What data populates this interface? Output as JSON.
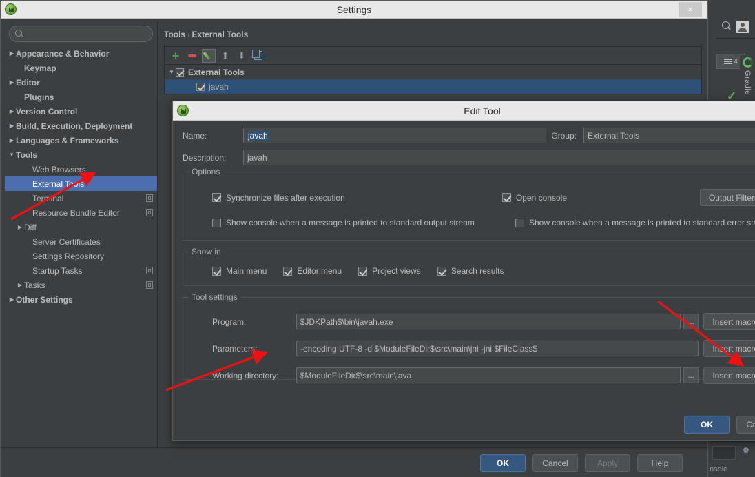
{
  "window": {
    "title": "Settings",
    "close_label": "×",
    "icon": "android-studio-icon"
  },
  "sidebar": {
    "search": {
      "value": "",
      "placeholder": ""
    },
    "items": [
      {
        "label": "Appearance & Behavior",
        "arrow": "▶",
        "bold": true,
        "indent": 8,
        "badge": false,
        "selected": false
      },
      {
        "label": "Keymap",
        "arrow": "",
        "bold": true,
        "indent": 20,
        "badge": false,
        "selected": false
      },
      {
        "label": "Editor",
        "arrow": "▶",
        "bold": true,
        "indent": 8,
        "badge": false,
        "selected": false
      },
      {
        "label": "Plugins",
        "arrow": "",
        "bold": true,
        "indent": 20,
        "badge": false,
        "selected": false
      },
      {
        "label": "Version Control",
        "arrow": "▶",
        "bold": true,
        "indent": 8,
        "badge": false,
        "selected": false
      },
      {
        "label": "Build, Execution, Deployment",
        "arrow": "▶",
        "bold": true,
        "indent": 8,
        "badge": false,
        "selected": false
      },
      {
        "label": "Languages & Frameworks",
        "arrow": "▶",
        "bold": true,
        "indent": 8,
        "badge": false,
        "selected": false
      },
      {
        "label": "Tools",
        "arrow": "▼",
        "bold": true,
        "indent": 8,
        "badge": false,
        "selected": false
      },
      {
        "label": "Web Browsers",
        "arrow": "",
        "bold": false,
        "indent": 32,
        "badge": false,
        "selected": false
      },
      {
        "label": "External Tools",
        "arrow": "",
        "bold": false,
        "indent": 32,
        "badge": false,
        "selected": true
      },
      {
        "label": "Terminal",
        "arrow": "",
        "bold": false,
        "indent": 32,
        "badge": true,
        "selected": false
      },
      {
        "label": "Resource Bundle Editor",
        "arrow": "",
        "bold": false,
        "indent": 32,
        "badge": true,
        "selected": false
      },
      {
        "label": "Diff",
        "arrow": "▶",
        "bold": false,
        "indent": 20,
        "badge": false,
        "selected": false
      },
      {
        "label": "Server Certificates",
        "arrow": "",
        "bold": false,
        "indent": 32,
        "badge": false,
        "selected": false
      },
      {
        "label": "Settings Repository",
        "arrow": "",
        "bold": false,
        "indent": 32,
        "badge": false,
        "selected": false
      },
      {
        "label": "Startup Tasks",
        "arrow": "",
        "bold": false,
        "indent": 32,
        "badge": true,
        "selected": false
      },
      {
        "label": "Tasks",
        "arrow": "▶",
        "bold": false,
        "indent": 20,
        "badge": true,
        "selected": false
      },
      {
        "label": "Other Settings",
        "arrow": "▶",
        "bold": true,
        "indent": 8,
        "badge": false,
        "selected": false
      }
    ]
  },
  "main": {
    "breadcrumb": {
      "parent": "Tools",
      "separator": "›",
      "current": "External Tools"
    },
    "toolbar": [
      {
        "name": "add",
        "glyph": "+"
      },
      {
        "name": "remove",
        "glyph": "–"
      },
      {
        "name": "edit",
        "glyph": "✎"
      },
      {
        "name": "move-up",
        "glyph": "⬆"
      },
      {
        "name": "move-down",
        "glyph": "⬇"
      },
      {
        "name": "copy",
        "glyph": "⧉"
      }
    ],
    "tree": [
      {
        "label": "External Tools",
        "arrow": "▼",
        "checked": true,
        "indent": 8,
        "bold": true,
        "selected": false
      },
      {
        "label": "javah",
        "arrow": "",
        "checked": true,
        "indent": 38,
        "bold": false,
        "selected": true
      }
    ]
  },
  "settings_footer": {
    "ok": "OK",
    "cancel": "Cancel",
    "apply": "Apply",
    "help": "Help"
  },
  "edit_dialog": {
    "title": "Edit Tool",
    "name_label": "Name:",
    "name_value": "javah",
    "group_label": "Group:",
    "group_value": "External Tools",
    "description_label": "Description:",
    "description_value": "javah",
    "options": {
      "legend": "Options",
      "checkboxes": [
        {
          "label": "Synchronize files after execution",
          "checked": true
        },
        {
          "label": "Open console",
          "checked": true
        },
        {
          "label": "Show console when a message is printed to standard output stream",
          "checked": false
        },
        {
          "label": "Show console when a message is printed to standard error stream",
          "checked": false
        }
      ],
      "output_filters_button": "Output Filters..."
    },
    "show_in": {
      "legend": "Show in",
      "checkboxes": [
        {
          "label": "Main menu",
          "checked": true
        },
        {
          "label": "Editor menu",
          "checked": true
        },
        {
          "label": "Project views",
          "checked": true
        },
        {
          "label": "Search results",
          "checked": true
        }
      ]
    },
    "tool_settings": {
      "legend": "Tool settings",
      "rows": [
        {
          "label": "Program:",
          "value": "$JDKPath$\\bin\\javah.exe",
          "browse": "...",
          "insert": "Insert macro...",
          "has_browse": true
        },
        {
          "label": "Parameters:",
          "value": "-encoding UTF-8 -d $ModuleFileDir$\\src\\main\\jni -jni $FileClass$",
          "browse": "",
          "insert": "Insert macro...",
          "has_browse": false
        },
        {
          "label": "Working directory:",
          "value": "$ModuleFileDir$\\src\\main\\java",
          "browse": "...",
          "insert": "Insert macro...",
          "has_browse": true
        }
      ]
    },
    "footer": {
      "ok": "OK",
      "cancel": "Cancel"
    }
  },
  "ide_background": {
    "gradle_label": "Gradle",
    "editor_tab_count": "4",
    "console_label": "nsole"
  },
  "colors": {
    "accent_blue": "#4b6eaf",
    "selection_blue": "#2d5177",
    "primary_button": "#365880",
    "panel_bg": "#3c3f41",
    "field_bg": "#45494a",
    "text": "#bbbbbb",
    "annotation_red": "#ee1111",
    "green_add": "#499c54",
    "red_remove": "#c75450"
  }
}
